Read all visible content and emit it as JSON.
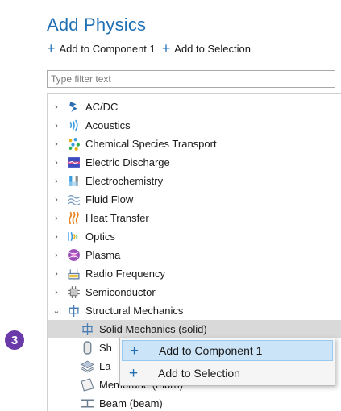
{
  "header": {
    "title": "Add Physics",
    "add_to_component_label": "Add to Component 1",
    "add_to_selection_label": "Add to Selection"
  },
  "filter": {
    "placeholder": "Type filter text",
    "value": ""
  },
  "tree": {
    "items": [
      {
        "label": "AC/DC",
        "expanded": false,
        "icon": "acdc-lightning-icon"
      },
      {
        "label": "Acoustics",
        "expanded": false,
        "icon": "acoustics-waves-icon"
      },
      {
        "label": "Chemical Species Transport",
        "expanded": false,
        "icon": "chemical-species-icon"
      },
      {
        "label": "Electric Discharge",
        "expanded": false,
        "icon": "electric-discharge-icon"
      },
      {
        "label": "Electrochemistry",
        "expanded": false,
        "icon": "electrochemistry-icon"
      },
      {
        "label": "Fluid Flow",
        "expanded": false,
        "icon": "fluid-flow-icon"
      },
      {
        "label": "Heat Transfer",
        "expanded": false,
        "icon": "heat-transfer-icon"
      },
      {
        "label": "Optics",
        "expanded": false,
        "icon": "optics-icon"
      },
      {
        "label": "Plasma",
        "expanded": false,
        "icon": "plasma-icon"
      },
      {
        "label": "Radio Frequency",
        "expanded": false,
        "icon": "radio-frequency-icon"
      },
      {
        "label": "Semiconductor",
        "expanded": false,
        "icon": "semiconductor-icon"
      },
      {
        "label": "Structural Mechanics",
        "expanded": true,
        "icon": "structural-mechanics-icon"
      }
    ],
    "children": [
      {
        "label": "Solid Mechanics (solid)",
        "selected": true,
        "icon": "solid-mechanics-icon"
      },
      {
        "label": "Sh",
        "icon": "shell-icon"
      },
      {
        "label": "La",
        "icon": "layered-shell-icon"
      },
      {
        "label": "Membrane (mbrn)",
        "icon": "membrane-icon"
      },
      {
        "label": "Beam (beam)",
        "icon": "beam-icon"
      }
    ]
  },
  "step_badge": "3",
  "context_menu": {
    "items": [
      {
        "label": "Add to Component 1",
        "highlighted": true
      },
      {
        "label": "Add to Selection",
        "highlighted": false
      }
    ]
  },
  "colors": {
    "accent": "#1f6fb5",
    "badge": "#6a3aa8",
    "highlight": "#cce4f7"
  }
}
